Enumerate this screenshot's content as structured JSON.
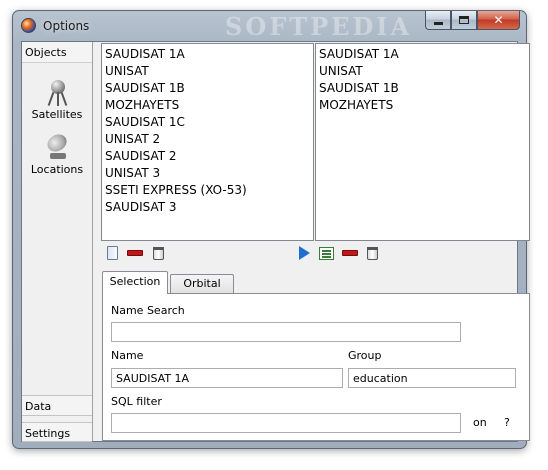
{
  "window": {
    "title": "Options",
    "watermark": "SOFTPEDIA",
    "minimize_icon": "minimize-icon",
    "maximize_icon": "maximize-icon",
    "close_glyph": "✕"
  },
  "sidebar": {
    "objects_label": "Objects",
    "items": [
      {
        "label": "Satellites",
        "icon": "satellite-icon"
      },
      {
        "label": "Locations",
        "icon": "satellite-dish-icon"
      }
    ],
    "data_label": "Data",
    "settings_label": "Settings"
  },
  "lists": {
    "available": [
      "SAUDISAT 1A",
      "UNISAT",
      "SAUDISAT 1B",
      "MOZHAYETS",
      "SAUDISAT 1C",
      "UNISAT 2",
      "SAUDISAT 2",
      "UNISAT 3",
      "SSETI EXPRESS (XO-53)",
      "SAUDISAT 3"
    ],
    "selected": [
      "SAUDISAT 1A",
      "UNISAT",
      "SAUDISAT 1B",
      "MOZHAYETS"
    ]
  },
  "tabs": {
    "selection": "Selection",
    "orbital": "Orbital"
  },
  "form": {
    "name_search_label": "Name Search",
    "name_search_value": "",
    "name_label": "Name",
    "name_value": "SAUDISAT 1A",
    "group_label": "Group",
    "group_value": "education",
    "sql_label": "SQL filter",
    "sql_value": "",
    "on_label": "on",
    "help_label": "?"
  }
}
